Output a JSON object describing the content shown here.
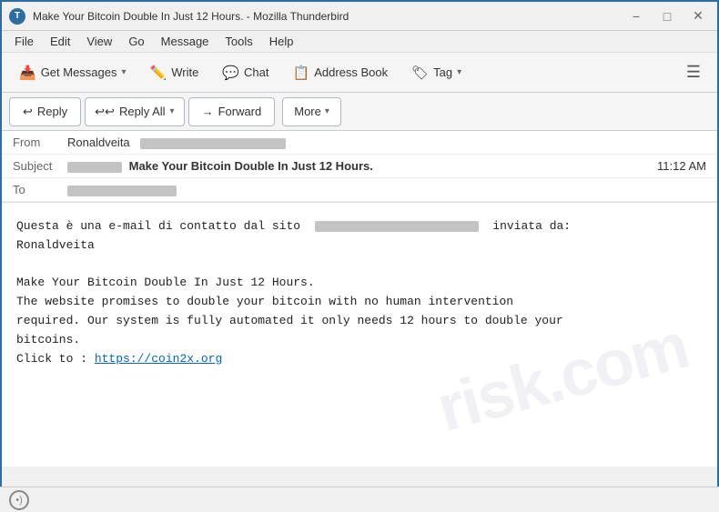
{
  "titleBar": {
    "icon": "T",
    "title": "Make Your Bitcoin Double In Just 12 Hours. - Mozilla Thunderbird",
    "minimize": "−",
    "maximize": "□",
    "close": "✕"
  },
  "menuBar": {
    "items": [
      "File",
      "Edit",
      "View",
      "Go",
      "Message",
      "Tools",
      "Help"
    ]
  },
  "toolbar": {
    "getMessages": "Get Messages",
    "write": "Write",
    "chat": "Chat",
    "addressBook": "Address Book",
    "tag": "Tag",
    "hamburger": "☰"
  },
  "actionBar": {
    "reply": "Reply",
    "replyAll": "Reply All",
    "forward": "Forward",
    "more": "More"
  },
  "emailHeader": {
    "fromLabel": "From",
    "fromName": "Ronaldveita",
    "subjectLabel": "Subject",
    "subjectPrefix": "",
    "subjectText": "Make Your Bitcoin Double In Just 12 Hours.",
    "time": "11:12 AM",
    "toLabel": "To"
  },
  "emailBody": {
    "line1a": "Questa è una e-mail di contatto dal sito",
    "line1b": "inviata da:",
    "line1c": "Ronaldveita",
    "line2": "",
    "line3": "Make Your Bitcoin Double In Just 12 Hours.",
    "line4": "The website promises to double your bitcoin with no human intervention",
    "line5": "required. Our system is fully automated it only needs 12 hours to double your",
    "line6": "bitcoins.",
    "line7a": "Click to : ",
    "link": "https://coin2x.org"
  },
  "watermark": "risk.com",
  "statusBar": {
    "icon": "(•)"
  }
}
